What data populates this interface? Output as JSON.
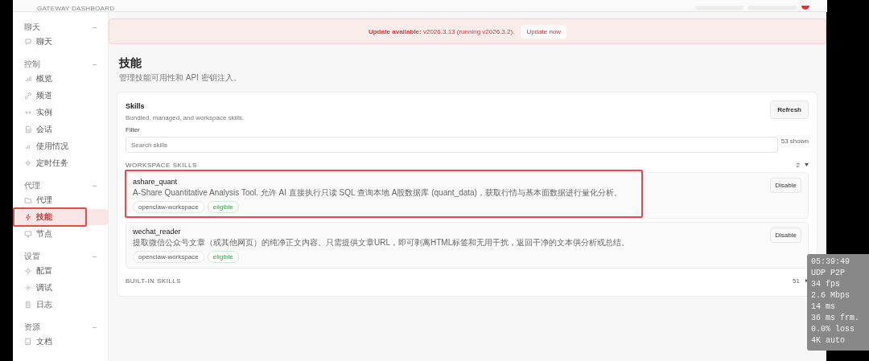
{
  "topbar": {
    "brand_subtitle": "GATEWAY DASHBOARD"
  },
  "sidebar": {
    "groups": [
      {
        "label": "聊天",
        "items": [
          {
            "label": "聊天",
            "selected": false,
            "annotated": false
          }
        ]
      },
      {
        "label": "控制",
        "items": [
          {
            "label": "概览",
            "selected": false,
            "annotated": false
          },
          {
            "label": "频道",
            "selected": false,
            "annotated": false
          },
          {
            "label": "实例",
            "selected": false,
            "annotated": false
          },
          {
            "label": "会话",
            "selected": false,
            "annotated": false
          },
          {
            "label": "使用情况",
            "selected": false,
            "annotated": false
          },
          {
            "label": "定时任务",
            "selected": false,
            "annotated": false
          }
        ]
      },
      {
        "label": "代理",
        "items": [
          {
            "label": "代理",
            "selected": false,
            "annotated": false
          },
          {
            "label": "技能",
            "selected": true,
            "annotated": true
          },
          {
            "label": "节点",
            "selected": false,
            "annotated": false
          }
        ]
      },
      {
        "label": "设置",
        "items": [
          {
            "label": "配置",
            "selected": false,
            "annotated": false
          },
          {
            "label": "调试",
            "selected": false,
            "annotated": false
          },
          {
            "label": "日志",
            "selected": false,
            "annotated": false
          }
        ]
      },
      {
        "label": "资源",
        "items": [
          {
            "label": "文档",
            "selected": false,
            "annotated": false
          }
        ]
      }
    ]
  },
  "banner": {
    "text": "**Update available:** v2026.3.13 (running v2026.3.2).",
    "button": "Update now"
  },
  "page": {
    "title": "技能",
    "subtitle": "管理技能可用性和 API 密钥注入。"
  },
  "skills_card": {
    "title": "Skills",
    "subtitle": "Bundled, managed, and workspace skills.",
    "refresh_button": "Refresh",
    "filter_label": "Filter",
    "search_placeholder": "Search skills",
    "shown_count": "53 shown",
    "sections": [
      {
        "label": "WORKSPACE SKILLS",
        "count": "2",
        "expanded": true,
        "skills": [
          {
            "name": "ashare_quant",
            "description": "A-Share Quantitative Analysis Tool. 允许 AI 直接执行只读 SQL 查询本地 A股数据库 (quant_data)，获取行情与基本面数据进行量化分析。",
            "tags": [
              {
                "label": "openclaw-workspace",
                "kind": "source"
              },
              {
                "label": "eligible",
                "kind": "status"
              }
            ],
            "button": "Disable",
            "annotated": true
          },
          {
            "name": "wechat_reader",
            "description": "提取微信公众号文章（或其他网页）的纯净正文内容。只需提供文章URL，即可剥离HTML标签和无用干扰，返回干净的文本供分析或总结。",
            "tags": [
              {
                "label": "openclaw-workspace",
                "kind": "source"
              },
              {
                "label": "eligible",
                "kind": "status"
              }
            ],
            "button": "Disable",
            "annotated": false
          }
        ]
      },
      {
        "label": "BUILT-IN SKILLS",
        "count": "51",
        "expanded": false
      }
    ]
  },
  "stats_overlay": {
    "lines": [
      "05:39:49",
      "UDP P2P",
      "34 fps",
      "2.6 Mbps",
      "14 ms",
      "36 ms frm.",
      "0.0% loss",
      "4K auto"
    ]
  }
}
